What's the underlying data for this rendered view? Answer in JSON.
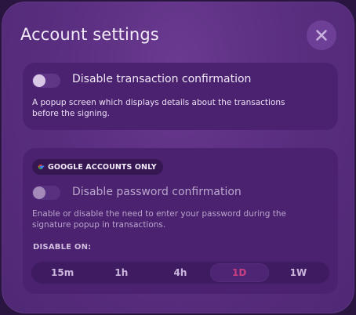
{
  "modal": {
    "title": "Account settings",
    "close_icon": "close-icon"
  },
  "transaction": {
    "toggle_on": false,
    "label": "Disable transaction confirmation",
    "description_line1": "A popup screen which displays details about the transactions",
    "description_line2": "before the signing."
  },
  "password": {
    "badge_icon": "google-icon",
    "badge_label": "GOOGLE ACCOUNTS ONLY",
    "toggle_on": false,
    "toggle_disabled": true,
    "label": "Disable password confirmation",
    "description_line1": "Enable or disable the need to enter your password during the",
    "description_line2": "signature popup in transactions.",
    "disable_on_label": "DISABLE ON:",
    "options": [
      "15m",
      "1h",
      "4h",
      "1D",
      "1W"
    ],
    "selected": "1D"
  },
  "colors": {
    "accent": "#c8407f",
    "background": "#5a2e80",
    "card": "#4a2270"
  }
}
